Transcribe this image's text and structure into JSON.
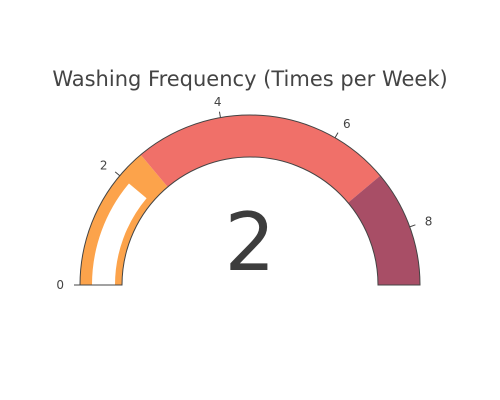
{
  "chart_data": {
    "type": "gauge",
    "title": "Washing Frequency (Times per Week)",
    "value": 2,
    "value_label": "2",
    "range": [
      0,
      9
    ],
    "ticks": [
      0,
      2,
      4,
      6,
      8
    ],
    "tick_labels": [
      "0",
      "2",
      "4",
      "6",
      "8"
    ],
    "steps": [
      {
        "range": [
          0,
          2.5
        ],
        "color": "#fca34b"
      },
      {
        "range": [
          2.5,
          7
        ],
        "color": "#f07069"
      },
      {
        "range": [
          7,
          9
        ],
        "color": "#a84e66"
      }
    ],
    "bar_color": "#ffffff"
  }
}
